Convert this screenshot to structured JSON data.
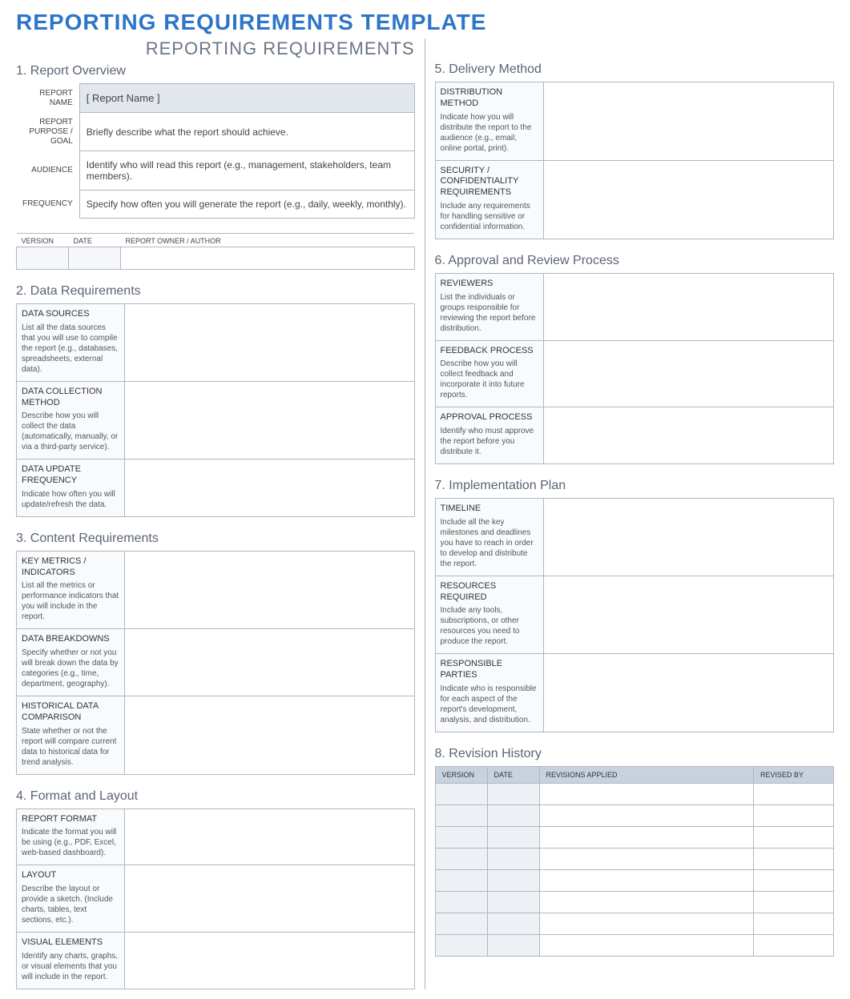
{
  "doc_title": "REPORTING REQUIREMENTS TEMPLATE",
  "subheading": "REPORTING REQUIREMENTS",
  "sections": {
    "s1": {
      "title": "1. Report Overview",
      "rows": [
        {
          "label": "REPORT NAME",
          "value": "[ Report Name ]"
        },
        {
          "label": "REPORT PURPOSE / GOAL",
          "value": "Briefly describe what the report should achieve."
        },
        {
          "label": "AUDIENCE",
          "value": "Identify who will read this report (e.g., management, stakeholders, team members)."
        },
        {
          "label": "FREQUENCY",
          "value": "Specify how often you will generate the report (e.g., daily, weekly, monthly)."
        }
      ],
      "strip_headers": [
        "VERSION",
        "DATE",
        "REPORT OWNER / AUTHOR"
      ]
    },
    "s2": {
      "title": "2. Data Requirements",
      "rows": [
        {
          "head": "DATA SOURCES",
          "desc": "List all the data sources that you will use to compile the report (e.g., databases, spreadsheets, external data)."
        },
        {
          "head": "DATA COLLECTION METHOD",
          "desc": "Describe how you will collect the data (automatically, manually, or via a third-party service)."
        },
        {
          "head": "DATA UPDATE FREQUENCY",
          "desc": "Indicate how often you will update/refresh the data."
        }
      ]
    },
    "s3": {
      "title": "3. Content Requirements",
      "rows": [
        {
          "head": "KEY METRICS / INDICATORS",
          "desc": "List all the metrics or performance indicators that you will include in the report."
        },
        {
          "head": "DATA BREAKDOWNS",
          "desc": "Specify whether or not you will break down the data by categories (e.g., time, department, geography)."
        },
        {
          "head": "HISTORICAL DATA COMPARISON",
          "desc": "State whether or not the report will compare current data to historical data for trend analysis."
        }
      ]
    },
    "s4": {
      "title": "4. Format and Layout",
      "rows": [
        {
          "head": "REPORT FORMAT",
          "desc": "Indicate the format you will be using (e.g., PDF, Excel, web-based dashboard)."
        },
        {
          "head": "LAYOUT",
          "desc": "Describe the layout or provide a sketch. (Include charts, tables, text sections, etc.)."
        },
        {
          "head": "VISUAL ELEMENTS",
          "desc": "Identify any charts, graphs, or visual elements that you will include in the report."
        }
      ]
    },
    "s5": {
      "title": "5. Delivery Method",
      "rows": [
        {
          "head": "DISTRIBUTION METHOD",
          "desc": "Indicate how you will distribute the report to the audience (e.g., email, online portal, print)."
        },
        {
          "head": "SECURITY / CONFIDENTIALITY REQUIREMENTS",
          "desc": "Include any requirements for handling sensitive or confidential information."
        }
      ]
    },
    "s6": {
      "title": "6. Approval and Review Process",
      "rows": [
        {
          "head": "REVIEWERS",
          "desc": "List the individuals or groups responsible for reviewing the report before distribution."
        },
        {
          "head": "FEEDBACK PROCESS",
          "desc": "Describe how you will collect feedback and incorporate it into future reports."
        },
        {
          "head": "APPROVAL PROCESS",
          "desc": "Identify who must approve the report before you distribute it."
        }
      ]
    },
    "s7": {
      "title": "7. Implementation Plan",
      "rows": [
        {
          "head": "TIMELINE",
          "desc": "Include all the key milestones and deadlines you have to reach in order to develop and distribute the report."
        },
        {
          "head": "RESOURCES REQUIRED",
          "desc": "Include any tools, subscriptions, or other resources you need to produce the report."
        },
        {
          "head": "RESPONSIBLE PARTIES",
          "desc": "Indicate who is responsible for each aspect of the report's development, analysis, and distribution."
        }
      ]
    },
    "s8": {
      "title": "8. Revision History",
      "headers": [
        "VERSION",
        "DATE",
        "REVISIONS APPLIED",
        "REVISED BY"
      ],
      "row_count": 8
    }
  }
}
